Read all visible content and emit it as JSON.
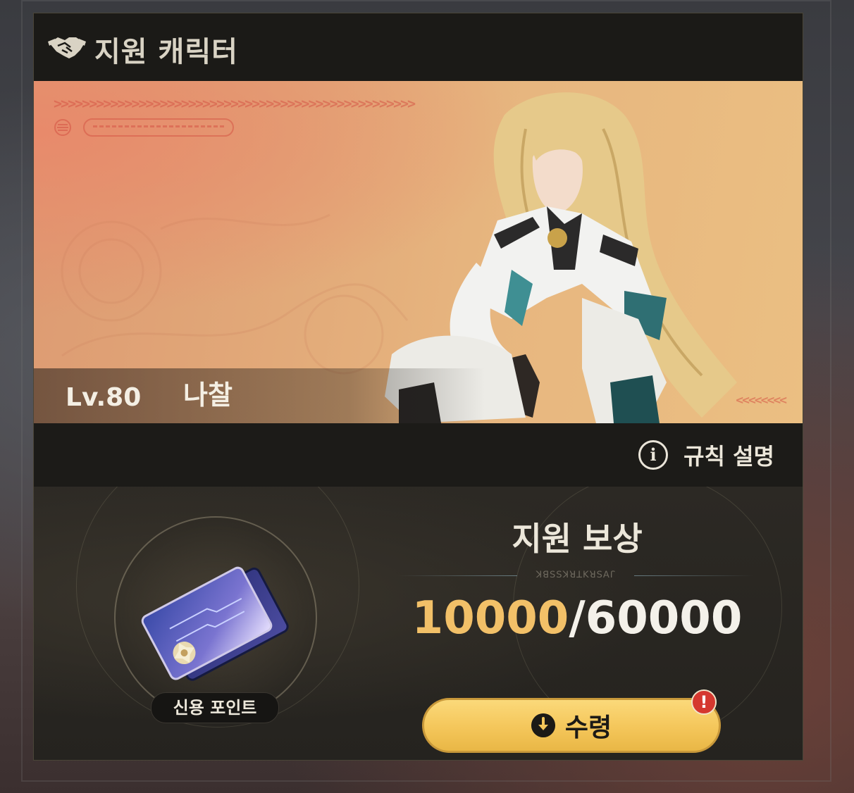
{
  "header": {
    "title": "지원 캐릭터",
    "icon": "handshake-icon"
  },
  "banner": {
    "level": "Lv.80",
    "character_name": "나찰",
    "chevrons": ">>>>>>>>>>>>>>>>>>>>>>>>>>>>>>>>>>>>>>>>>>>>>>>>>>>",
    "chevrons_right": "<<<<<<<<"
  },
  "rules": {
    "label": "규칙 설명",
    "icon_glyph": "i"
  },
  "reward": {
    "item_name": "신용 포인트",
    "title": "지원 보상",
    "subtitle_glyphs": "ꓘꓭꓢꓢꓘꓤꓕꓗꓤꓢꓮꓩ",
    "current": "10000",
    "separator": "/",
    "max": "60000",
    "claim_label": "수령",
    "alert_glyph": "!"
  },
  "colors": {
    "accent_gold": "#f2c068",
    "button_yellow": "#f4c65a",
    "alert_red": "#d5382f",
    "panel_dark": "#26241f"
  }
}
